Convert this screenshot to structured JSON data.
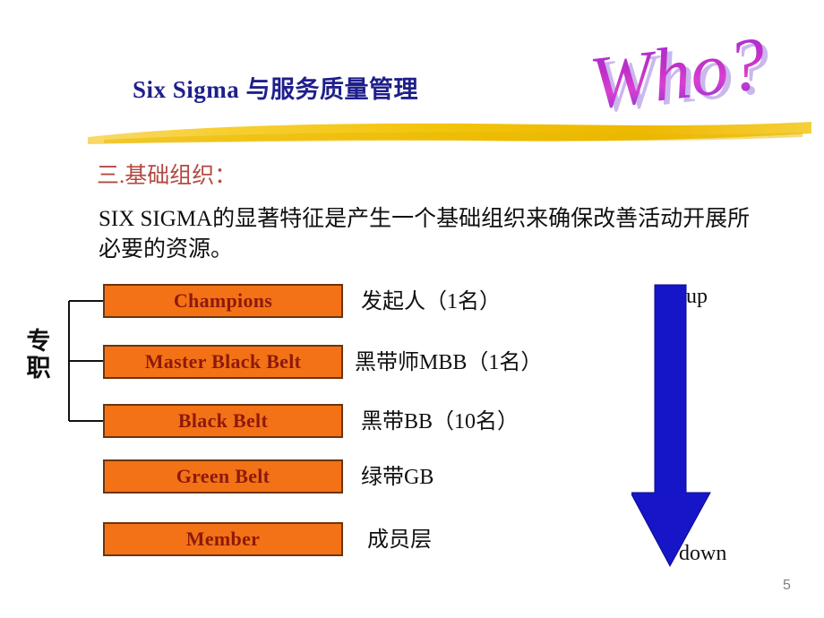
{
  "slide": {
    "title": "Six Sigma 与服务质量管理",
    "wordart": "Who?",
    "section_heading": "三.基础组织：",
    "body_text": "SIX SIGMA的显著特征是产生一个基础组织来确保改善活动开展所必要的资源。",
    "page_number": "5"
  },
  "org_chart": {
    "bracket_label": "专职",
    "rows": [
      {
        "role": "Champions",
        "description": "发起人（1名）"
      },
      {
        "role": "Master Black Belt",
        "description": "黑带师MBB（1名）"
      },
      {
        "role": "Black Belt",
        "description": "黑带BB（10名）"
      },
      {
        "role": "Green Belt",
        "description": "绿带GB"
      },
      {
        "role": "Member",
        "description": "成员层"
      }
    ]
  },
  "arrow": {
    "top_label": "up",
    "bottom_label": "down"
  },
  "colors": {
    "title": "#1f1f8c",
    "heading": "#b34a42",
    "box_fill": "#f47216",
    "box_border": "#6b3410",
    "box_text": "#8c1a0b",
    "arrow": "#1616c8",
    "divider": "#f5c417",
    "wordart_top": "#d63ad6",
    "wordart_bottom": "#7b2fd6",
    "page_number": "#808080"
  }
}
